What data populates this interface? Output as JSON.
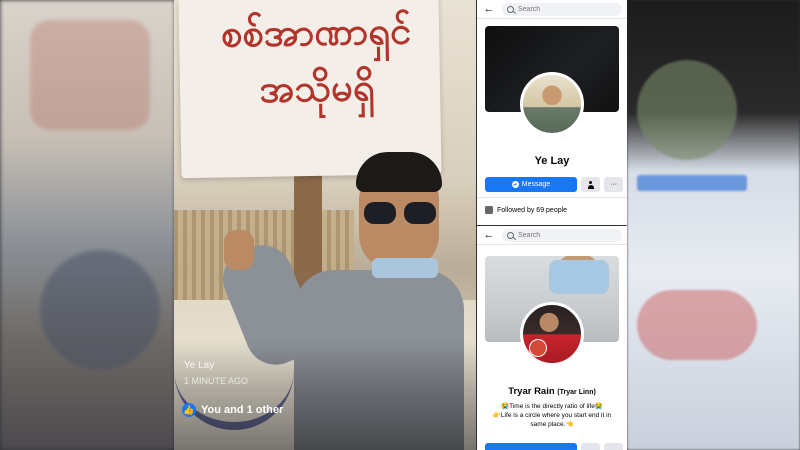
{
  "photo_post": {
    "sign_text": "စစ်အာဏာရှင်\nအသိုမရှိ",
    "poster_name": "Ye Lay",
    "time": "1 MINUTE AGO",
    "reactions_text": "You and 1 other"
  },
  "profile_ye_lay": {
    "search_placeholder": "Search",
    "name": "Ye Lay",
    "message_label": "Message",
    "more_label": "···",
    "followed_text": "Followed by 69 people"
  },
  "profile_tryar": {
    "search_placeholder": "Search",
    "name": "Tryar Rain",
    "alt_name": "(Tryar Linn)",
    "bio_line1": "😭Time is the directly ratio of life😭",
    "bio_line2": "👉Life is a circle where you start end it in same place.👈"
  },
  "colors": {
    "facebook_blue": "#1877f2",
    "sign_text_red": "#b2342b"
  }
}
